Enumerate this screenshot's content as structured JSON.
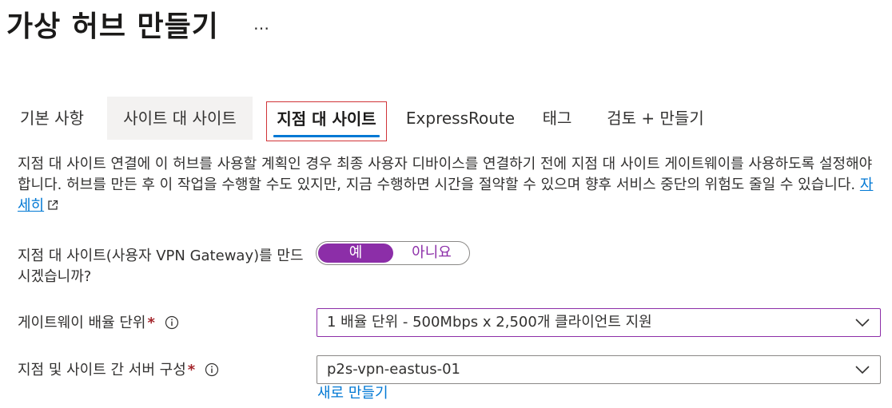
{
  "header": {
    "title": "가상 허브 만들기",
    "more_label": "…"
  },
  "tabs": [
    {
      "label": "기본 사항",
      "state": "normal"
    },
    {
      "label": "사이트 대 사이트",
      "state": "hover"
    },
    {
      "label": "지점 대 사이트",
      "state": "selected"
    },
    {
      "label": "ExpressRoute",
      "state": "normal"
    },
    {
      "label": "태그",
      "state": "normal"
    },
    {
      "label": "검토 + 만들기",
      "state": "normal"
    }
  ],
  "description": {
    "text": "지점 대 사이트 연결에 이 허브를 사용할 계획인 경우 최종 사용자 디바이스를 연결하기 전에 지점 대 사이트 게이트웨이를 사용하도록 설정해야 합니다. 허브를 만든 후 이 작업을 수행할 수도 있지만, 지금 수행하면 시간을 절약할 수 있으며 향후 서비스 중단의 위험도 줄일 수 있습니다.",
    "link_label": "자세히",
    "link_icon": "external-link-icon"
  },
  "form": {
    "p2s_toggle": {
      "label": "지점 대 사이트(사용자 VPN Gateway)를 만드시겠습니까?",
      "option_yes": "예",
      "option_no": "아니요",
      "selected": "예"
    },
    "scale_unit": {
      "label": "게이트웨이 배율 단위",
      "required_mark": "*",
      "info_icon": "info-icon",
      "value": "1 배율 단위 - 500Mbps x 2,500개 클라이언트 지원"
    },
    "server_config": {
      "label": "지점 및 사이트 간 서버 구성",
      "required_mark": "*",
      "info_icon": "info-icon",
      "value": "p2s-vpn-eastus-01",
      "create_new_label": "새로 만들기"
    }
  },
  "colors": {
    "accent_purple": "#8c2ea8",
    "link_blue": "#0078d4",
    "tab_underline": "#0078d4",
    "highlight_box": "#d13438",
    "required_red": "#a4262c"
  }
}
